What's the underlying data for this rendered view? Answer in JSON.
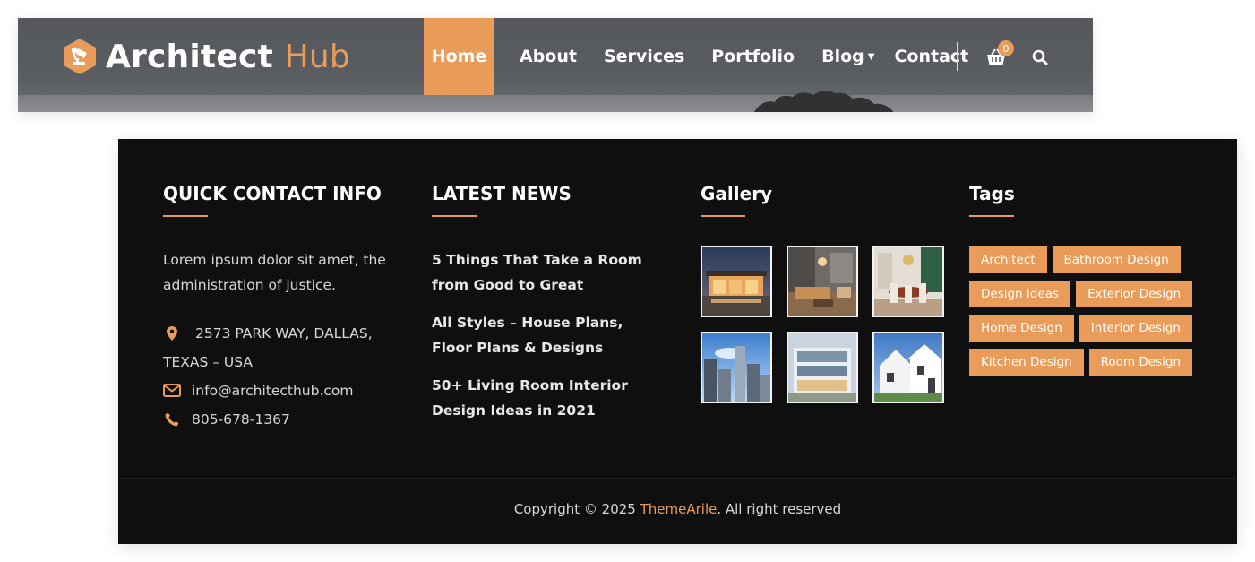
{
  "header": {
    "logo": {
      "word1": "Architect",
      "word2": "Hub"
    },
    "nav": [
      {
        "label": "Home",
        "active": true
      },
      {
        "label": "About"
      },
      {
        "label": "Services"
      },
      {
        "label": "Portfolio"
      },
      {
        "label": "Blog",
        "has_dropdown": true
      },
      {
        "label": "Contact"
      }
    ],
    "cart_count": "0",
    "icons": {
      "cart": "basket-icon",
      "search": "search-icon",
      "logo": "lamp-hexagon-icon"
    },
    "accent_color": "#e99b59"
  },
  "footer": {
    "contact": {
      "title": "QUICK CONTACT INFO",
      "description": "Lorem ipsum dolor sit amet, the administration of justice.",
      "address_line1": "2573 PARK WAY, DALLAS,",
      "address_line2": "TEXAS – USA",
      "email": "info@architecthub.com",
      "phone": "805-678-1367"
    },
    "news": {
      "title": "LATEST NEWS",
      "items": [
        "5 Things That Take a Room from Good to Great",
        "All Styles – House Plans, Floor Plans & Designs",
        "50+ Living Room Interior Design Ideas in 2021"
      ]
    },
    "gallery": {
      "title": "Gallery",
      "images": [
        "house-night-exterior",
        "living-room-interior",
        "dining-room-interior",
        "city-skyscrapers",
        "modern-building-facade",
        "white-house-exterior"
      ]
    },
    "tags": {
      "title": "Tags",
      "items": [
        "Architect",
        "Bathroom Design",
        "Design Ideas",
        "Exterior Design",
        "Home Design",
        "Interior Design",
        "Kitchen Design",
        "Room Design"
      ]
    },
    "copyright": {
      "prefix": "Copyright © 2025 ",
      "brand": "ThemeArile",
      "suffix": ". All right reserved"
    }
  }
}
